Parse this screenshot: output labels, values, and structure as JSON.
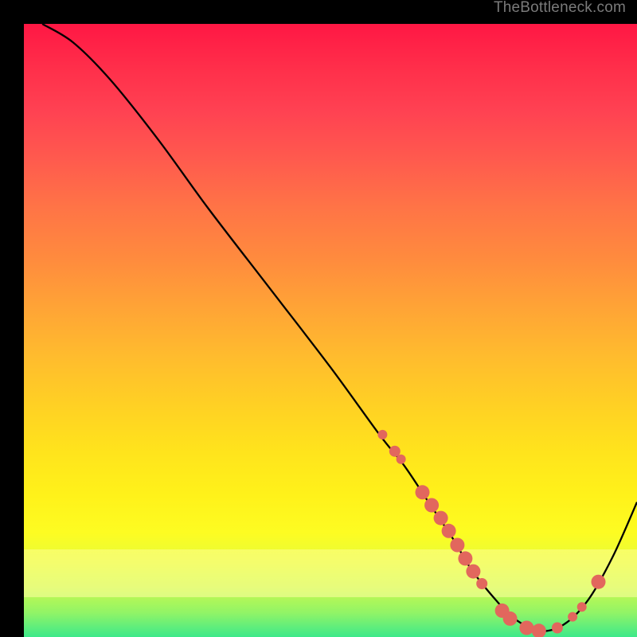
{
  "attribution": "TheBottleneck.com",
  "colors": {
    "dot": "#e2675d",
    "curve": "#000000",
    "background_top": "#ff1744",
    "background_bottom": "#3de98a"
  },
  "chart_data": {
    "type": "line",
    "title": "",
    "xlabel": "",
    "ylabel": "",
    "xlim": [
      0,
      100
    ],
    "ylim": [
      0,
      100
    ],
    "series": [
      {
        "name": "bottleneck-curve",
        "x": [
          3,
          8,
          14,
          22,
          30,
          40,
          50,
          58,
          62,
          66,
          70,
          73,
          77,
          80,
          84,
          88,
          92,
          96,
          100
        ],
        "y": [
          100,
          97,
          91,
          81,
          70,
          57,
          44,
          33,
          28,
          22,
          16,
          11,
          6,
          3,
          1,
          2,
          6,
          13,
          22
        ]
      }
    ],
    "markers": [
      {
        "x": 58.5,
        "y": 33.0,
        "r": 6
      },
      {
        "x": 60.5,
        "y": 30.3,
        "r": 7
      },
      {
        "x": 61.5,
        "y": 29.0,
        "r": 6
      },
      {
        "x": 65.0,
        "y": 23.6,
        "r": 9
      },
      {
        "x": 66.5,
        "y": 21.5,
        "r": 9
      },
      {
        "x": 68.0,
        "y": 19.4,
        "r": 9
      },
      {
        "x": 69.3,
        "y": 17.3,
        "r": 9
      },
      {
        "x": 70.7,
        "y": 15.0,
        "r": 9
      },
      {
        "x": 72.0,
        "y": 12.8,
        "r": 9
      },
      {
        "x": 73.3,
        "y": 10.7,
        "r": 9
      },
      {
        "x": 74.7,
        "y": 8.7,
        "r": 7
      },
      {
        "x": 78.0,
        "y": 4.3,
        "r": 9
      },
      {
        "x": 79.3,
        "y": 3.0,
        "r": 9
      },
      {
        "x": 82.0,
        "y": 1.5,
        "r": 9
      },
      {
        "x": 84.0,
        "y": 1.0,
        "r": 9
      },
      {
        "x": 87.0,
        "y": 1.5,
        "r": 7
      },
      {
        "x": 89.5,
        "y": 3.3,
        "r": 6
      },
      {
        "x": 91.0,
        "y": 4.9,
        "r": 6
      },
      {
        "x": 93.7,
        "y": 9.0,
        "r": 9
      }
    ]
  }
}
